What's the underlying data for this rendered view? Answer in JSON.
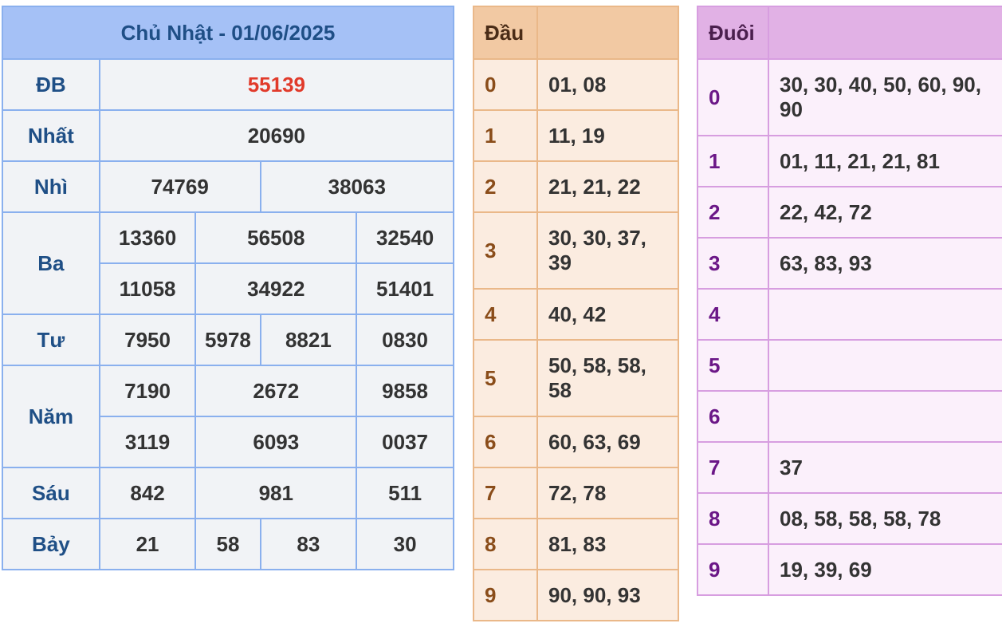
{
  "results": {
    "title": "Chủ Nhật - 01/06/2025",
    "dac_biet": {
      "label": "ĐB",
      "value": "55139"
    },
    "nhat": {
      "label": "Nhất",
      "value": "20690"
    },
    "nhi": {
      "label": "Nhì",
      "values": [
        "74769",
        "38063"
      ]
    },
    "ba": {
      "label": "Ba",
      "values": [
        "13360",
        "56508",
        "32540",
        "11058",
        "34922",
        "51401"
      ]
    },
    "tu": {
      "label": "Tư",
      "values": [
        "7950",
        "5978",
        "8821",
        "0830"
      ]
    },
    "nam": {
      "label": "Năm",
      "values": [
        "7190",
        "2672",
        "9858",
        "3119",
        "6093",
        "0037"
      ]
    },
    "sau": {
      "label": "Sáu",
      "values": [
        "842",
        "981",
        "511"
      ]
    },
    "bay": {
      "label": "Bảy",
      "values": [
        "21",
        "58",
        "83",
        "30"
      ]
    },
    "special_color": "#e13a2a"
  },
  "dau": {
    "header": "Đầu",
    "header_value": "",
    "rows": [
      {
        "key": "0",
        "value": "01, 08"
      },
      {
        "key": "1",
        "value": "11, 19"
      },
      {
        "key": "2",
        "value": "21, 21, 22"
      },
      {
        "key": "3",
        "value": "30, 30, 37, 39"
      },
      {
        "key": "4",
        "value": "40, 42"
      },
      {
        "key": "5",
        "value": "50, 58, 58, 58"
      },
      {
        "key": "6",
        "value": "60, 63, 69"
      },
      {
        "key": "7",
        "value": "72, 78"
      },
      {
        "key": "8",
        "value": "81, 83"
      },
      {
        "key": "9",
        "value": "90, 90, 93"
      }
    ]
  },
  "duoi": {
    "header": "Đuôi",
    "header_value": "",
    "rows": [
      {
        "key": "0",
        "value": "30, 30, 40, 50, 60, 90, 90"
      },
      {
        "key": "1",
        "value": "01, 11, 21, 21, 81"
      },
      {
        "key": "2",
        "value": "22, 42, 72"
      },
      {
        "key": "3",
        "value": "63, 83, 93"
      },
      {
        "key": "4",
        "value": ""
      },
      {
        "key": "5",
        "value": ""
      },
      {
        "key": "6",
        "value": ""
      },
      {
        "key": "7",
        "value": "37"
      },
      {
        "key": "8",
        "value": "08, 58, 58, 58, 78"
      },
      {
        "key": "9",
        "value": "19, 39, 69"
      }
    ]
  }
}
